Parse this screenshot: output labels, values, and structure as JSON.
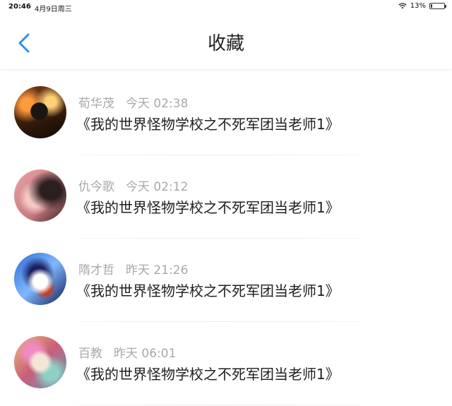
{
  "status_bar": {
    "time": "20:46",
    "date": "4月9日周三",
    "battery": "13%",
    "battery_level": 0.13
  },
  "nav": {
    "title": "收藏"
  },
  "favorites": [
    {
      "author": "荀华茂",
      "time": "今天 02:38",
      "book_title": "《我的世界怪物学校之不死军团当老师1》"
    },
    {
      "author": "仇今歌",
      "time": "今天 02:12",
      "book_title": "《我的世界怪物学校之不死军团当老师1》"
    },
    {
      "author": "隋才哲",
      "time": "昨天 21:26",
      "book_title": "《我的世界怪物学校之不死军团当老师1》"
    },
    {
      "author": "百教",
      "time": "昨天 06:01",
      "book_title": "《我的世界怪物学校之不死军团当老师1》"
    }
  ],
  "colors": {
    "accent": "#2f8ff0",
    "meta_text": "#a8a8a8",
    "title_text": "#1f1f1f"
  },
  "icons": {
    "back": "chevron-left-icon",
    "wifi": "wifi-icon",
    "battery": "battery-icon"
  }
}
